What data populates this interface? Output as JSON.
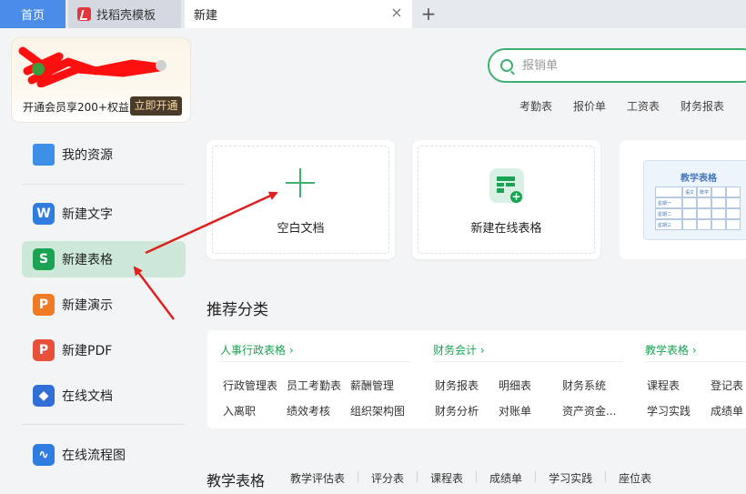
{
  "tabs": {
    "home": "首页",
    "template": "找稻壳模板",
    "new": "新建",
    "close_symbol": "×",
    "add_symbol": "+"
  },
  "sidebar": {
    "vip": {
      "text": "开通会员享200+权益",
      "button": "立即开通"
    },
    "items": [
      {
        "label": "我的资源",
        "icon": "folder-icon",
        "color": "#3d8fe8"
      },
      {
        "label": "新建文字",
        "icon": "writer-icon",
        "color": "#2f7de1"
      },
      {
        "label": "新建表格",
        "icon": "spreadsheet-icon",
        "color": "#1aa352"
      },
      {
        "label": "新建演示",
        "icon": "presentation-icon",
        "color": "#f07b24"
      },
      {
        "label": "新建PDF",
        "icon": "pdf-icon",
        "color": "#e8503a"
      },
      {
        "label": "在线文档",
        "icon": "cloud-doc-icon",
        "color": "#2f6fd6"
      },
      {
        "label": "在线流程图",
        "icon": "flowchart-icon",
        "color": "#2f7de1"
      }
    ]
  },
  "search": {
    "placeholder": "报销单",
    "hot_links": [
      "考勤表",
      "报价单",
      "工资表",
      "财务报表"
    ]
  },
  "cards": {
    "blank_doc": "空白文档",
    "online_sheet": "新建在线表格",
    "template_preview": {
      "title": "教学表格",
      "col1": "语文",
      "col2": "数学",
      "rows": [
        "星期一",
        "星期二",
        "星期三"
      ]
    }
  },
  "recommend": {
    "title": "推荐分类",
    "groups": [
      {
        "head": "人事行政表格 ›",
        "items": [
          "行政管理表",
          "员工考勤表",
          "薪酬管理",
          "入离职",
          "绩效考核",
          "组织架构图"
        ]
      },
      {
        "head": "财务会计 ›",
        "items": [
          "财务报表",
          "明细表",
          "财务系统",
          "财务分析",
          "对账单",
          "资产资金..."
        ]
      },
      {
        "head": "教学表格 ›",
        "items": [
          "课程表",
          "登记表",
          "学习实践",
          "成绩单"
        ]
      }
    ]
  },
  "teaching": {
    "title": "教学表格",
    "links": [
      "教学评估表",
      "评分表",
      "课程表",
      "成绩单",
      "学习实践",
      "座位表"
    ]
  },
  "colors": {
    "accent": "#1aa352",
    "home_tab": "#4a8ce8",
    "annotation": "#e02020"
  }
}
